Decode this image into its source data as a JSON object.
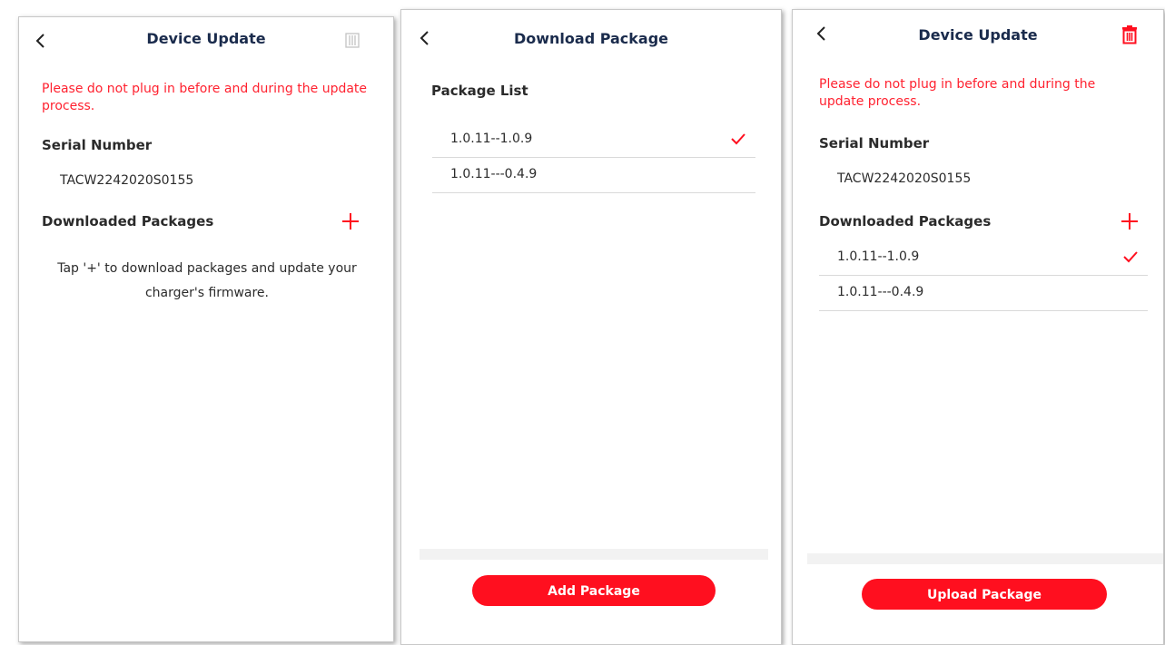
{
  "colors": {
    "accent": "#ff0f1f",
    "warning": "#ff2230",
    "title": "#1a2b4c",
    "text": "#2b2b2b"
  },
  "screen1": {
    "title": "Device Update",
    "icons": {
      "back": "back-chevron-icon",
      "trash": "trash-icon"
    },
    "warning": "Please do not plug in before and during the update process.",
    "serial_label": "Serial Number",
    "serial_value": "TACW2242020S0155",
    "packages_label": "Downloaded Packages",
    "hint_line1": "Tap '+' to download packages and update your",
    "hint_line2": "charger's firmware."
  },
  "screen2": {
    "title": "Download Package",
    "icons": {
      "back": "back-chevron-icon",
      "check": "checkmark-icon"
    },
    "list_label": "Package List",
    "packages": [
      {
        "label": "1.0.11--1.0.9",
        "selected": true
      },
      {
        "label": "1.0.11---0.4.9",
        "selected": false
      }
    ],
    "button_label": "Add Package"
  },
  "screen3": {
    "title": "Device Update",
    "icons": {
      "back": "back-chevron-icon",
      "trash": "trash-icon",
      "plus": "plus-icon"
    },
    "warning": "Please do not plug in before and during the update process.",
    "serial_label": "Serial Number",
    "serial_value": "TACW2242020S0155",
    "packages_label": "Downloaded Packages",
    "packages": [
      {
        "label": "1.0.11--1.0.9",
        "selected": true
      },
      {
        "label": "1.0.11---0.4.9",
        "selected": false
      }
    ],
    "button_label": "Upload Package"
  }
}
